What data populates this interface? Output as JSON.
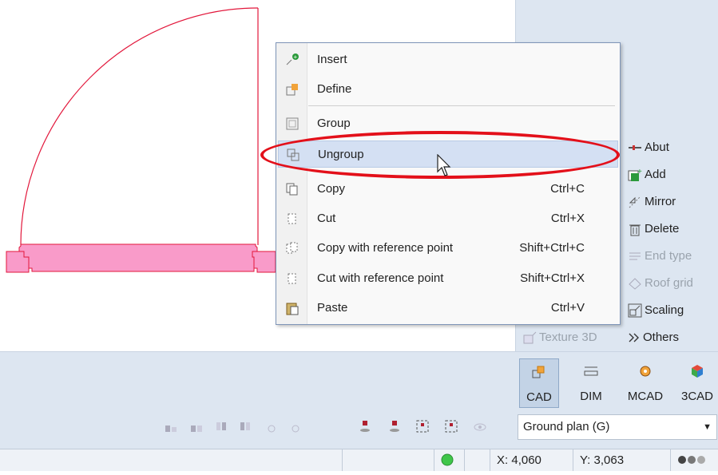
{
  "context_menu": {
    "items": [
      {
        "label": "Insert",
        "shortcut": "",
        "icon": "insert-icon"
      },
      {
        "label": "Define",
        "shortcut": "",
        "icon": "define-icon"
      },
      {
        "label": "Group",
        "shortcut": "",
        "icon": "group-icon"
      },
      {
        "label": "Ungroup",
        "shortcut": "",
        "icon": "ungroup-icon"
      },
      {
        "label": "Copy",
        "shortcut": "Ctrl+C",
        "icon": "copy-icon"
      },
      {
        "label": "Cut",
        "shortcut": "Ctrl+X",
        "icon": "cut-icon"
      },
      {
        "label": "Copy with reference point",
        "shortcut": "Shift+Ctrl+C",
        "icon": "copy-reference-icon"
      },
      {
        "label": "Cut with reference point",
        "shortcut": "Shift+Ctrl+X",
        "icon": "cut-reference-icon"
      },
      {
        "label": "Paste",
        "shortcut": "Ctrl+V",
        "icon": "paste-icon"
      }
    ]
  },
  "tools": {
    "abut": "Abut",
    "add": "Add",
    "mirror": "Mirror",
    "delete": "Delete",
    "end_type": "End type",
    "roof_grid": "Roof grid",
    "scaling": "Scaling",
    "texture_3d": "Texture 3D",
    "others": "Others"
  },
  "modes": [
    {
      "label": "CAD",
      "active": true
    },
    {
      "label": "DIM",
      "active": false
    },
    {
      "label": "MCAD",
      "active": false
    },
    {
      "label": "3CAD",
      "active": false
    }
  ],
  "view_select": {
    "value": "Ground plan  (G)"
  },
  "status": {
    "x_label": "X:",
    "x_value": "4,060",
    "y_label": "Y:",
    "y_value": "3,063"
  },
  "colors": {
    "accent_red": "#e3101a",
    "wall_fill": "#f99bc9",
    "wall_stroke": "#e2173b",
    "status_green": "#3fc64a"
  }
}
